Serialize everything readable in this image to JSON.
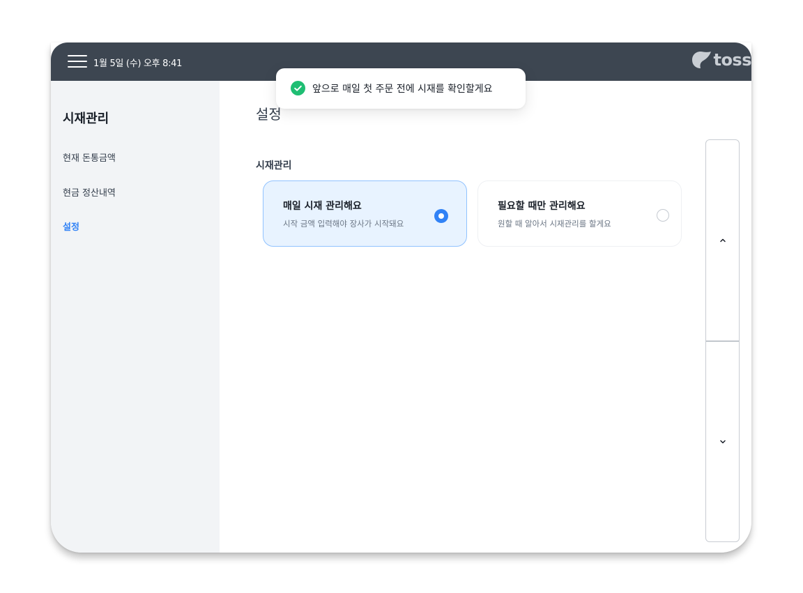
{
  "header": {
    "datetime": "1월 5일 (수) 오후 8:41",
    "logo_text": "toss",
    "logo_color": "#c9ced4",
    "icons": [
      "menu-icon",
      "toss-logo-icon"
    ]
  },
  "sidebar": {
    "title": "시재관리",
    "items": [
      {
        "label": "현재 돈통금액",
        "active": false
      },
      {
        "label": "현금 정산내역",
        "active": false
      },
      {
        "label": "설정",
        "active": true
      }
    ]
  },
  "main": {
    "title": "설정",
    "section_label": "시재관리",
    "options": [
      {
        "title": "매일 시재 관리해요",
        "description": "시작 금액 입력해야 장사가 시작돼요",
        "selected": true
      },
      {
        "title": "필요할 때만 관리해요",
        "description": "원할 때 알아서 시재관리를 할게요",
        "selected": false
      }
    ]
  },
  "scroll": {
    "up_icon": "chevron-up-icon",
    "down_icon": "chevron-down-icon"
  },
  "toast": {
    "message": "앞으로 매일 첫 주문 전에 시재를 확인할게요",
    "icon": "check-circle-icon",
    "icon_color": "#1fbe73"
  },
  "colors": {
    "topbar": "#3d4651",
    "accent": "#3182f6",
    "sidebar_bg": "#f2f4f6",
    "selected_bg": "#e8f3ff"
  }
}
